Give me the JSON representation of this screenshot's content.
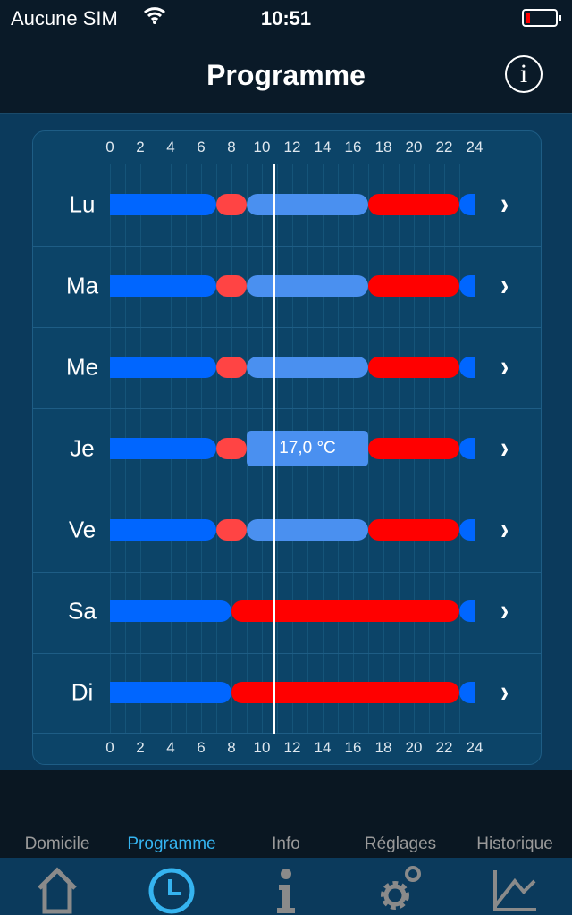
{
  "status": {
    "carrier": "Aucune SIM",
    "time": "10:51",
    "battery_level": 0.1
  },
  "header": {
    "title": "Programme",
    "info_icon": "info-circle-icon"
  },
  "schedule": {
    "hours": [
      "0",
      "2",
      "4",
      "6",
      "8",
      "10",
      "12",
      "14",
      "16",
      "18",
      "20",
      "22",
      "24"
    ],
    "current_time_hours": 10.85,
    "colors": {
      "eco": "#0066ff",
      "comfort": "#ff0000",
      "comfort_light": "#ff4444",
      "away": "#4a90f0"
    },
    "days": [
      {
        "label": "Lu",
        "segments": [
          [
            0,
            7,
            "eco"
          ],
          [
            7,
            9,
            "comfort_light"
          ],
          [
            9,
            17,
            "away"
          ],
          [
            17,
            23,
            "comfort"
          ],
          [
            23,
            24,
            "eco"
          ]
        ]
      },
      {
        "label": "Ma",
        "segments": [
          [
            0,
            7,
            "eco"
          ],
          [
            7,
            9,
            "comfort_light"
          ],
          [
            9,
            17,
            "away"
          ],
          [
            17,
            23,
            "comfort"
          ],
          [
            23,
            24,
            "eco"
          ]
        ]
      },
      {
        "label": "Me",
        "segments": [
          [
            0,
            7,
            "eco"
          ],
          [
            7,
            9,
            "comfort_light"
          ],
          [
            9,
            17,
            "away"
          ],
          [
            17,
            23,
            "comfort"
          ],
          [
            23,
            24,
            "eco"
          ]
        ]
      },
      {
        "label": "Je",
        "segments": [
          [
            0,
            7,
            "eco"
          ],
          [
            7,
            9,
            "comfort_light"
          ],
          [
            9,
            17,
            "away"
          ],
          [
            17,
            23,
            "comfort"
          ],
          [
            23,
            24,
            "eco"
          ]
        ],
        "tooltip": {
          "text": "17,0 °C",
          "start": 9,
          "end": 17
        }
      },
      {
        "label": "Ve",
        "segments": [
          [
            0,
            7,
            "eco"
          ],
          [
            7,
            9,
            "comfort_light"
          ],
          [
            9,
            17,
            "away"
          ],
          [
            17,
            23,
            "comfort"
          ],
          [
            23,
            24,
            "eco"
          ]
        ]
      },
      {
        "label": "Sa",
        "segments": [
          [
            0,
            8,
            "eco"
          ],
          [
            8,
            23,
            "comfort"
          ],
          [
            23,
            24,
            "eco"
          ]
        ]
      },
      {
        "label": "Di",
        "segments": [
          [
            0,
            8,
            "eco"
          ],
          [
            8,
            23,
            "comfort"
          ],
          [
            23,
            24,
            "eco"
          ]
        ]
      }
    ]
  },
  "tabbar": {
    "items": [
      {
        "label": "Domicile",
        "icon": "house-icon"
      },
      {
        "label": "Programme",
        "icon": "clock-icon",
        "active": true
      },
      {
        "label": "Info",
        "icon": "info-icon"
      },
      {
        "label": "Réglages",
        "icon": "gears-icon"
      },
      {
        "label": "Historique",
        "icon": "chart-icon"
      }
    ]
  }
}
